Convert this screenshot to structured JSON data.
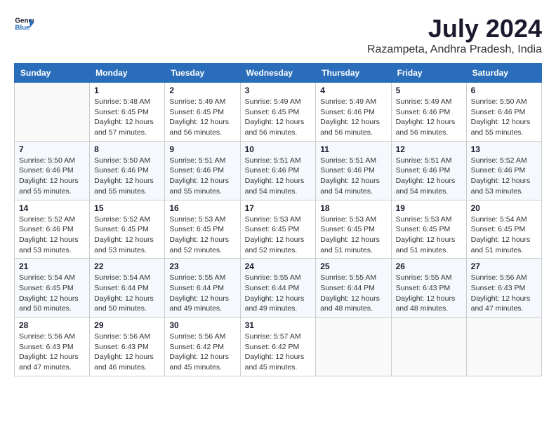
{
  "header": {
    "logo_line1": "General",
    "logo_line2": "Blue",
    "month_title": "July 2024",
    "location": "Razampeta, Andhra Pradesh, India"
  },
  "days_of_week": [
    "Sunday",
    "Monday",
    "Tuesday",
    "Wednesday",
    "Thursday",
    "Friday",
    "Saturday"
  ],
  "weeks": [
    [
      {
        "day": "",
        "info": ""
      },
      {
        "day": "1",
        "info": "Sunrise: 5:48 AM\nSunset: 6:45 PM\nDaylight: 12 hours\nand 57 minutes."
      },
      {
        "day": "2",
        "info": "Sunrise: 5:49 AM\nSunset: 6:45 PM\nDaylight: 12 hours\nand 56 minutes."
      },
      {
        "day": "3",
        "info": "Sunrise: 5:49 AM\nSunset: 6:45 PM\nDaylight: 12 hours\nand 56 minutes."
      },
      {
        "day": "4",
        "info": "Sunrise: 5:49 AM\nSunset: 6:46 PM\nDaylight: 12 hours\nand 56 minutes."
      },
      {
        "day": "5",
        "info": "Sunrise: 5:49 AM\nSunset: 6:46 PM\nDaylight: 12 hours\nand 56 minutes."
      },
      {
        "day": "6",
        "info": "Sunrise: 5:50 AM\nSunset: 6:46 PM\nDaylight: 12 hours\nand 55 minutes."
      }
    ],
    [
      {
        "day": "7",
        "info": "Sunrise: 5:50 AM\nSunset: 6:46 PM\nDaylight: 12 hours\nand 55 minutes."
      },
      {
        "day": "8",
        "info": "Sunrise: 5:50 AM\nSunset: 6:46 PM\nDaylight: 12 hours\nand 55 minutes."
      },
      {
        "day": "9",
        "info": "Sunrise: 5:51 AM\nSunset: 6:46 PM\nDaylight: 12 hours\nand 55 minutes."
      },
      {
        "day": "10",
        "info": "Sunrise: 5:51 AM\nSunset: 6:46 PM\nDaylight: 12 hours\nand 54 minutes."
      },
      {
        "day": "11",
        "info": "Sunrise: 5:51 AM\nSunset: 6:46 PM\nDaylight: 12 hours\nand 54 minutes."
      },
      {
        "day": "12",
        "info": "Sunrise: 5:51 AM\nSunset: 6:46 PM\nDaylight: 12 hours\nand 54 minutes."
      },
      {
        "day": "13",
        "info": "Sunrise: 5:52 AM\nSunset: 6:46 PM\nDaylight: 12 hours\nand 53 minutes."
      }
    ],
    [
      {
        "day": "14",
        "info": "Sunrise: 5:52 AM\nSunset: 6:46 PM\nDaylight: 12 hours\nand 53 minutes."
      },
      {
        "day": "15",
        "info": "Sunrise: 5:52 AM\nSunset: 6:45 PM\nDaylight: 12 hours\nand 53 minutes."
      },
      {
        "day": "16",
        "info": "Sunrise: 5:53 AM\nSunset: 6:45 PM\nDaylight: 12 hours\nand 52 minutes."
      },
      {
        "day": "17",
        "info": "Sunrise: 5:53 AM\nSunset: 6:45 PM\nDaylight: 12 hours\nand 52 minutes."
      },
      {
        "day": "18",
        "info": "Sunrise: 5:53 AM\nSunset: 6:45 PM\nDaylight: 12 hours\nand 51 minutes."
      },
      {
        "day": "19",
        "info": "Sunrise: 5:53 AM\nSunset: 6:45 PM\nDaylight: 12 hours\nand 51 minutes."
      },
      {
        "day": "20",
        "info": "Sunrise: 5:54 AM\nSunset: 6:45 PM\nDaylight: 12 hours\nand 51 minutes."
      }
    ],
    [
      {
        "day": "21",
        "info": "Sunrise: 5:54 AM\nSunset: 6:45 PM\nDaylight: 12 hours\nand 50 minutes."
      },
      {
        "day": "22",
        "info": "Sunrise: 5:54 AM\nSunset: 6:44 PM\nDaylight: 12 hours\nand 50 minutes."
      },
      {
        "day": "23",
        "info": "Sunrise: 5:55 AM\nSunset: 6:44 PM\nDaylight: 12 hours\nand 49 minutes."
      },
      {
        "day": "24",
        "info": "Sunrise: 5:55 AM\nSunset: 6:44 PM\nDaylight: 12 hours\nand 49 minutes."
      },
      {
        "day": "25",
        "info": "Sunrise: 5:55 AM\nSunset: 6:44 PM\nDaylight: 12 hours\nand 48 minutes."
      },
      {
        "day": "26",
        "info": "Sunrise: 5:55 AM\nSunset: 6:43 PM\nDaylight: 12 hours\nand 48 minutes."
      },
      {
        "day": "27",
        "info": "Sunrise: 5:56 AM\nSunset: 6:43 PM\nDaylight: 12 hours\nand 47 minutes."
      }
    ],
    [
      {
        "day": "28",
        "info": "Sunrise: 5:56 AM\nSunset: 6:43 PM\nDaylight: 12 hours\nand 47 minutes."
      },
      {
        "day": "29",
        "info": "Sunrise: 5:56 AM\nSunset: 6:43 PM\nDaylight: 12 hours\nand 46 minutes."
      },
      {
        "day": "30",
        "info": "Sunrise: 5:56 AM\nSunset: 6:42 PM\nDaylight: 12 hours\nand 45 minutes."
      },
      {
        "day": "31",
        "info": "Sunrise: 5:57 AM\nSunset: 6:42 PM\nDaylight: 12 hours\nand 45 minutes."
      },
      {
        "day": "",
        "info": ""
      },
      {
        "day": "",
        "info": ""
      },
      {
        "day": "",
        "info": ""
      }
    ]
  ]
}
